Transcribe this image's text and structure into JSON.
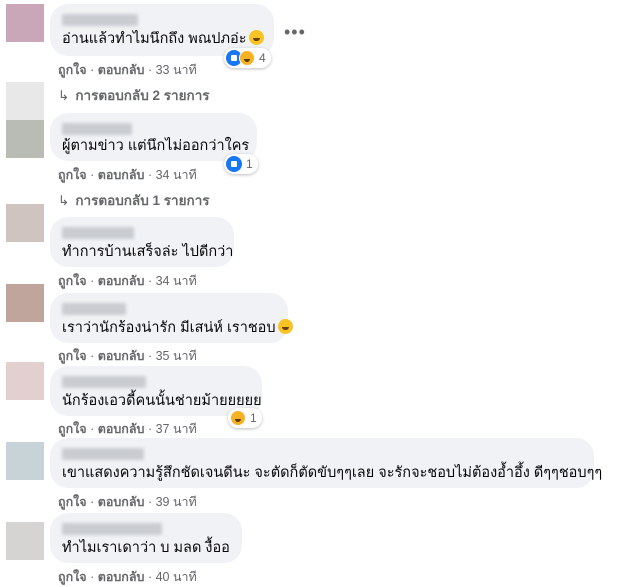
{
  "comments": [
    {
      "text": "อ่านแล้วทำไมนึกถึง พณปภอ่ะ",
      "emoji": true,
      "like": "ถูกใจ",
      "reply": "ตอบกลับ",
      "time": "33 นาที",
      "reaction_count": "4",
      "reaction_types": [
        "like-icon",
        "haha-icon"
      ],
      "replies": "การตอบกลับ 2 รายการ",
      "avatar_color": "#c9a7b8"
    },
    {
      "text": "ผู้ตามข่าว แต่นึกไม่ออกว่าใคร",
      "emoji": false,
      "like": "ถูกใจ",
      "reply": "ตอบกลับ",
      "time": "34 นาที",
      "reaction_count": "1",
      "reaction_types": [
        "like-icon"
      ],
      "replies": "การตอบกลับ 1 รายการ",
      "avatar_color": "#b8bcb4"
    },
    {
      "text": "ทำการบ้านเสร็จล่ะ ไปดีกว่า",
      "emoji": false,
      "like": "ถูกใจ",
      "reply": "ตอบกลับ",
      "time": "34 นาที",
      "avatar_color": "#cfc4bf"
    },
    {
      "text": "เราว่านักร้องน่ารัก มีเสน่ห์ เราชอบ",
      "emoji": true,
      "like": "ถูกใจ",
      "reply": "ตอบกลับ",
      "time": "35 นาที",
      "avatar_color": "#c0a59d"
    },
    {
      "text": "นักร้องเอวดี้คนนั้นช่ายม้ายยยยย",
      "emoji": false,
      "like": "ถูกใจ",
      "reply": "ตอบกลับ",
      "time": "37 นาที",
      "reaction_count": "1",
      "reaction_types": [
        "haha-icon"
      ],
      "avatar_color": "#e3cfcf"
    },
    {
      "text": "เขาแสดงความรู้สึกชัดเจนดีนะ จะตัดก็ตัดขับๆๆเลย จะรักจะชอบไม่ต้องอ้ำอึ้ง ดีๆๆชอบๆๆ",
      "emoji": false,
      "like": "ถูกใจ",
      "reply": "ตอบกลับ",
      "time": "39 นาที",
      "avatar_color": "#c7d3d6"
    },
    {
      "text": "ทำไมเราเดาว่า บ มลด งื้ออ",
      "emoji": false,
      "like": "ถูกใจ",
      "reply": "ตอบกลับ",
      "time": "40 นาที",
      "avatar_color": "#d6d3d3"
    }
  ],
  "more_icon": "•••",
  "reply_arrow": "↳",
  "separator": "·"
}
